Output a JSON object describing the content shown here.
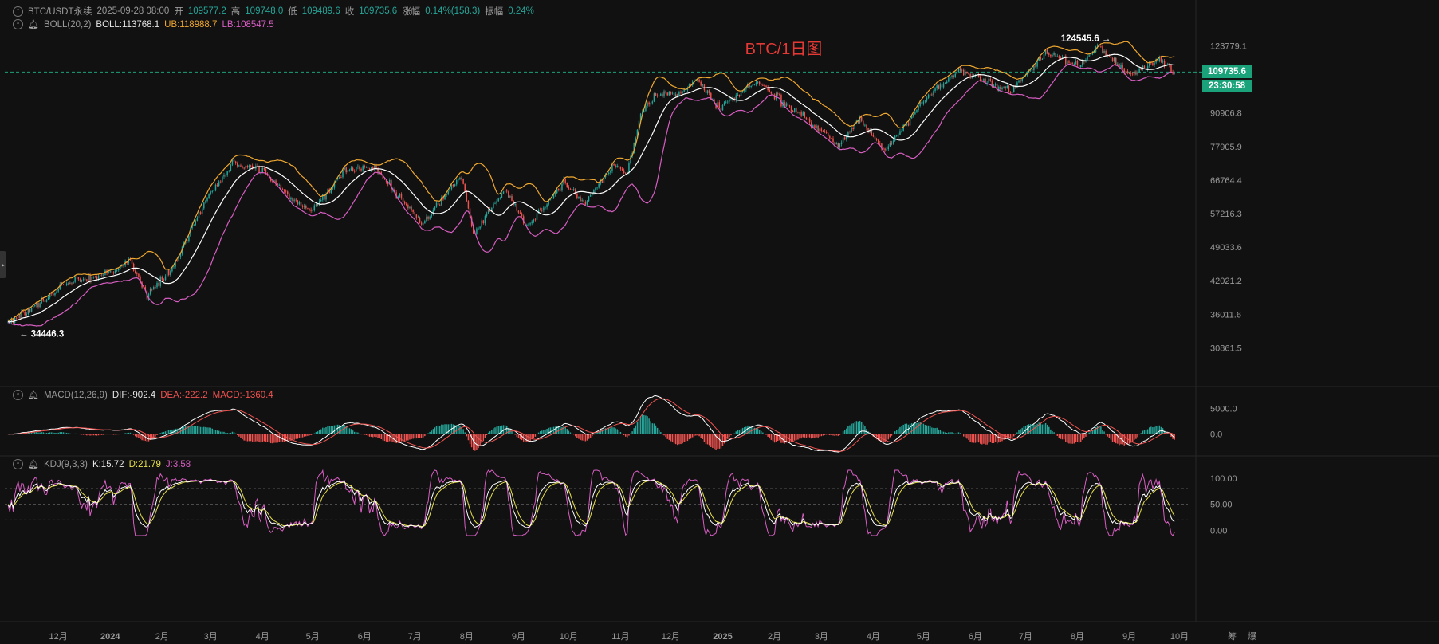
{
  "header": {
    "symbol": "BTC/USDT永续",
    "datetime": "2025-09-28 08:00",
    "open_label": "开",
    "open": "109577.2",
    "high_label": "高",
    "high": "109748.0",
    "low_label": "低",
    "low": "109489.6",
    "close_label": "收",
    "close": "109735.6",
    "change_label": "涨幅",
    "change": "0.14%(158.3)",
    "amp_label": "振幅",
    "amp": "0.24%"
  },
  "boll": {
    "name": "BOLL(20,2)",
    "mid": "BOLL:113768.1",
    "ub": "UB:118988.7",
    "lb": "LB:108547.5"
  },
  "macd": {
    "name": "MACD(12,26,9)",
    "dif": "DIF:-902.4",
    "dea": "DEA:-222.2",
    "macd": "MACD:-1360.4"
  },
  "kdj": {
    "name": "KDJ(9,3,3)",
    "k": "K:15.72",
    "d": "D:21.79",
    "j": "J:3.58"
  },
  "price_tag": "109735.6",
  "countdown_tag": "23:30:58",
  "corner_labels": [
    "筹",
    "爆"
  ],
  "colors": {
    "up": "#26a69a",
    "down": "#ef5350",
    "mid": "#ffffff",
    "ub": "#f0a830",
    "lb": "#d85ec3",
    "dea": "#ef5350",
    "kdj_d": "#e8e04a",
    "tag": "#1aa37a"
  },
  "chart_data": {
    "type": "candlestick",
    "title": "BTC/1日图",
    "price_axis": {
      "ticks": [
        "123779.1",
        "109735.6",
        "90906.8",
        "77905.9",
        "66764.4",
        "57216.3",
        "49033.6",
        "42021.2",
        "36011.6",
        "30861.5"
      ],
      "scale": "log",
      "ylim": [
        26500,
        132000
      ]
    },
    "x_ticks": [
      "12月",
      "2024",
      "2月",
      "3月",
      "4月",
      "5月",
      "6月",
      "7月",
      "8月",
      "9月",
      "10月",
      "11月",
      "12月",
      "2025",
      "2月",
      "3月",
      "4月",
      "5月",
      "6月",
      "7月",
      "8月",
      "9月",
      "10月"
    ],
    "x_tick_dates": [
      "2023-12-01",
      "2024-01-01",
      "2024-02-01",
      "2024-03-01",
      "2024-04-01",
      "2024-05-01",
      "2024-06-01",
      "2024-07-01",
      "2024-08-01",
      "2024-09-01",
      "2024-10-01",
      "2024-11-01",
      "2024-12-01",
      "2025-01-01",
      "2025-02-01",
      "2025-03-01",
      "2025-04-01",
      "2025-05-01",
      "2025-06-01",
      "2025-07-01",
      "2025-08-01",
      "2025-09-01",
      "2025-10-01"
    ],
    "annotations": [
      {
        "text": "124545.6 →",
        "date": "2025-08-14",
        "price": 124545.6
      },
      {
        "text": "← 34446.3",
        "date": "2023-11-05",
        "price": 34446.3
      }
    ],
    "price_key_points": [
      [
        "2023-11-01",
        34500
      ],
      [
        "2023-11-15",
        37000
      ],
      [
        "2023-12-05",
        41500
      ],
      [
        "2023-12-20",
        42500
      ],
      [
        "2024-01-05",
        44000
      ],
      [
        "2024-01-12",
        46500
      ],
      [
        "2024-01-23",
        39500
      ],
      [
        "2024-02-08",
        45000
      ],
      [
        "2024-02-28",
        62000
      ],
      [
        "2024-03-14",
        71500
      ],
      [
        "2024-04-01",
        70000
      ],
      [
        "2024-04-17",
        61500
      ],
      [
        "2024-05-01",
        58000
      ],
      [
        "2024-05-20",
        70000
      ],
      [
        "2024-06-07",
        71000
      ],
      [
        "2024-07-05",
        54500
      ],
      [
        "2024-07-29",
        68000
      ],
      [
        "2024-08-05",
        52000
      ],
      [
        "2024-08-24",
        64000
      ],
      [
        "2024-09-06",
        53800
      ],
      [
        "2024-09-28",
        66000
      ],
      [
        "2024-10-10",
        60000
      ],
      [
        "2024-10-29",
        72000
      ],
      [
        "2024-11-05",
        69000
      ],
      [
        "2024-11-13",
        90000
      ],
      [
        "2024-11-22",
        99000
      ],
      [
        "2024-12-06",
        99500
      ],
      [
        "2024-12-17",
        106000
      ],
      [
        "2024-12-30",
        93000
      ],
      [
        "2025-01-21",
        105000
      ],
      [
        "2025-02-03",
        97000
      ],
      [
        "2025-02-25",
        86000
      ],
      [
        "2025-03-11",
        78000
      ],
      [
        "2025-03-24",
        88000
      ],
      [
        "2025-04-08",
        76500
      ],
      [
        "2025-05-01",
        96000
      ],
      [
        "2025-05-22",
        111000
      ],
      [
        "2025-06-22",
        101000
      ],
      [
        "2025-07-14",
        120000
      ],
      [
        "2025-08-02",
        113000
      ],
      [
        "2025-08-14",
        123500
      ],
      [
        "2025-09-01",
        108000
      ],
      [
        "2025-09-18",
        117000
      ],
      [
        "2025-09-28",
        109735.6
      ]
    ],
    "macd_axis": {
      "ticks": [
        "5000.0",
        "0.0"
      ],
      "ylim": [
        -3500,
        6500
      ]
    },
    "kdj_axis": {
      "ticks": [
        "100.00",
        "50.00",
        "0.00"
      ],
      "ylim": [
        -10,
        115
      ],
      "levels": [
        20,
        50,
        80
      ]
    }
  }
}
